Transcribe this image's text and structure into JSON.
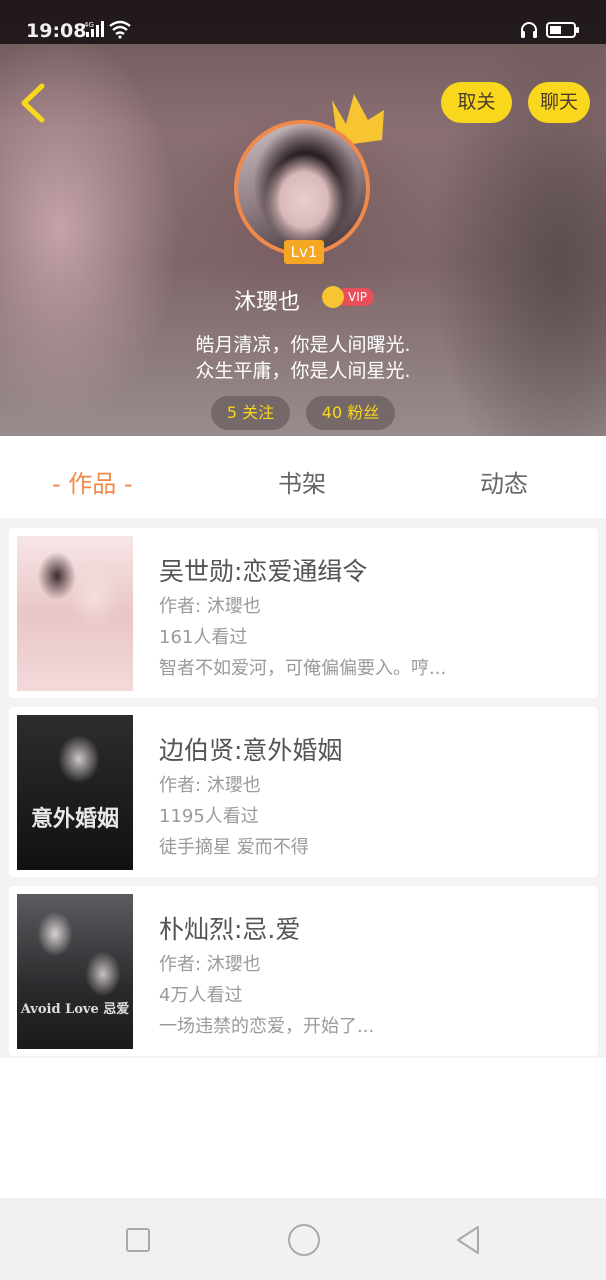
{
  "status_bar": {
    "time": "19:08",
    "network": "4G",
    "icons": [
      "signal-icon",
      "wifi-icon",
      "headset-icon",
      "battery-icon"
    ]
  },
  "header": {
    "back_icon": "chevron-left-icon",
    "unfollow_label": "取关",
    "chat_label": "聊天",
    "level": "Lv1",
    "username": "沐瓔也",
    "vip_label": "VIP",
    "bio_line1": "皓月清凉，你是人间曙光.",
    "bio_line2": "众生平庸，你是人间星光.",
    "follow_stat": "5 关注",
    "fans_stat": "40 粉丝"
  },
  "tabs": [
    {
      "label": "- 作品 -",
      "active": true
    },
    {
      "label": "书架",
      "active": false
    },
    {
      "label": "动态",
      "active": false
    }
  ],
  "works": [
    {
      "title": "吴世勋:恋爱通缉令",
      "author": "作者: 沐瓔也",
      "views": "161人看过",
      "description": "智者不如爱河，可俺偏偏要入。哼..."
    },
    {
      "title": "边伯贤:意外婚姻",
      "author": "作者: 沐瓔也",
      "views": "1195人看过",
      "description": "徒手摘星  爱而不得",
      "cover_text": "意外婚姻"
    },
    {
      "title": "朴灿烈:忌.爱",
      "author": "作者: 沐瓔也",
      "views": "4万人看过",
      "description": "一场违禁的恋爱，开始了...",
      "cover_text": "Avoid Love 忌爱"
    }
  ],
  "colors": {
    "accent_yellow": "#f9d71c",
    "active_tab": "#f08a4b",
    "vip_red": "#e94f5a"
  },
  "nav_bar": {
    "icons": [
      "recent-apps-icon",
      "home-icon",
      "back-icon"
    ]
  }
}
